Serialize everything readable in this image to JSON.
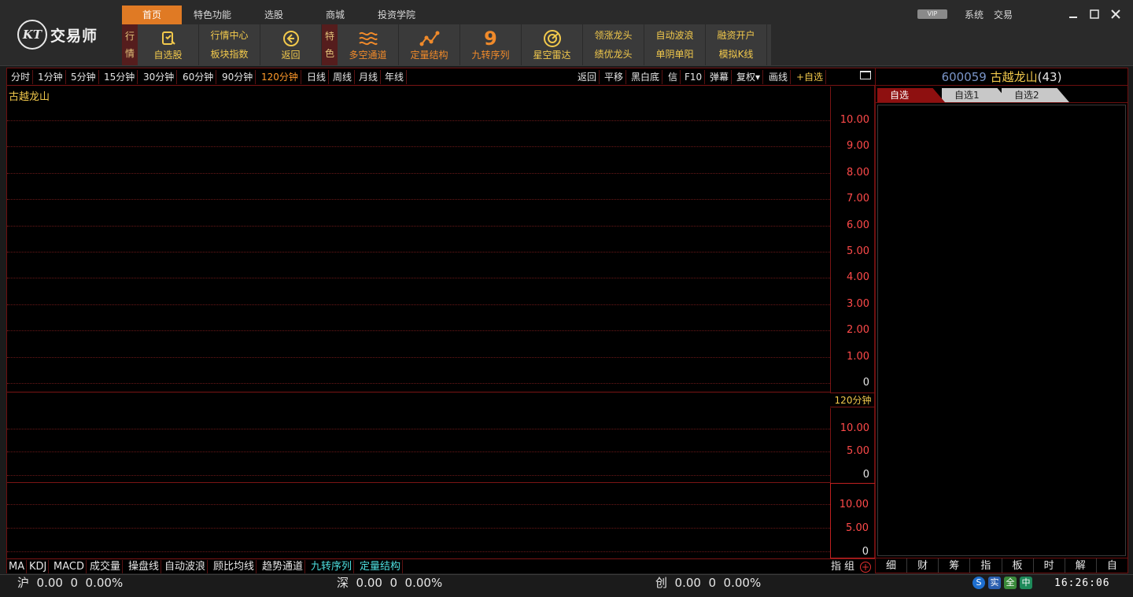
{
  "app": {
    "logo_mark": "KT",
    "logo_text": "交易师"
  },
  "menu_tabs": [
    {
      "label": "首页",
      "active": true
    },
    {
      "label": "特色功能"
    },
    {
      "label": "选股"
    },
    {
      "label": "商城"
    },
    {
      "label": "投资学院"
    }
  ],
  "toolbar": {
    "group1_label": [
      "行",
      "情"
    ],
    "watchlist": "自选股",
    "market_center": "行情中心",
    "sector_index": "板块指数",
    "back": "返回",
    "group2_label": [
      "特",
      "色"
    ],
    "multi_channel": "多空通道",
    "quant_structure": "定量结构",
    "nine_digit": "9",
    "nine_sequence": "九转序列",
    "star_radar": "星空雷达",
    "lead_dragon": "领涨龙头",
    "best_dragon": "绩优龙头",
    "auto_wave": "自动波浪",
    "single_yinyang": "单阴单阳",
    "margin_account": "融资开户",
    "sim_kline": "模拟K线"
  },
  "top_right": {
    "vip": "VIP",
    "system": "系统",
    "trade": "交易"
  },
  "period_tabs": [
    "分时",
    "1分钟",
    "5分钟",
    "15分钟",
    "30分钟",
    "60分钟",
    "90分钟",
    "120分钟",
    "日线",
    "周线",
    "月线",
    "年线"
  ],
  "active_period": "120分钟",
  "chart_tools": [
    "返回",
    "平移",
    "黑白底",
    "信",
    "F10",
    "弹幕",
    "复权▾",
    "画线",
    "+自选"
  ],
  "stock_title": "古越龙山",
  "main_axis": [
    "10.00",
    "9.00",
    "8.00",
    "7.00",
    "6.00",
    "5.00",
    "4.00",
    "3.00",
    "2.00",
    "1.00",
    "0"
  ],
  "period_readout": "120分钟",
  "vol_axis": [
    "10.00",
    "5.00",
    "0"
  ],
  "ind_axis": [
    "10.00",
    "5.00",
    "0"
  ],
  "indicator_tabs": [
    {
      "label": "MA"
    },
    {
      "label": "KDJ"
    },
    {
      "label": "MACD"
    },
    {
      "label": "成交量"
    },
    {
      "label": "操盘线"
    },
    {
      "label": "自动波浪"
    },
    {
      "label": "顾比均线"
    },
    {
      "label": "趋势通道"
    },
    {
      "label": "九转序列",
      "cyan": true
    },
    {
      "label": "定量结构",
      "cyan": true
    }
  ],
  "indicator_right": {
    "zhi": "指",
    "zu": "组",
    "add": "+"
  },
  "right_panel": {
    "code": "600059",
    "name": "古越龙山",
    "count": "(43)",
    "tabs": [
      "自选",
      "自选1",
      "自选2"
    ],
    "bottom_tabs": [
      "细",
      "财",
      "筹",
      "指",
      "板",
      "时",
      "解",
      "自"
    ]
  },
  "status": {
    "sh": "沪  0.00  0  0.00%",
    "sz": "深  0.00  0  0.00%",
    "cy": "创  0.00  0  0.00%",
    "icons": [
      "S",
      "实",
      "全",
      "中"
    ],
    "clock": "16:26:06"
  },
  "colors": {
    "accent": "#e07a24",
    "gold": "#f2c94c",
    "axis_red": "#ff4a4a",
    "grid_red": "#6a1818",
    "cyan": "#4ee0e0"
  }
}
